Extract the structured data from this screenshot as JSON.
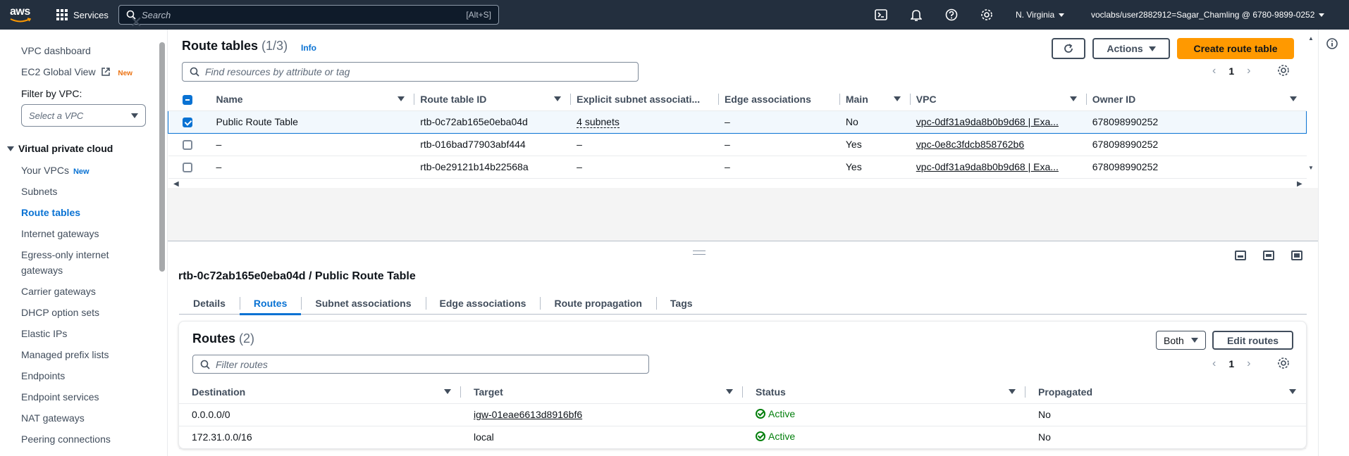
{
  "topnav": {
    "logo_text": "aws",
    "services_label": "Services",
    "search_placeholder": "Search",
    "search_shortcut": "[Alt+S]",
    "region": "N. Virginia",
    "account": "voclabs/user2882912=Sagar_Chamling @ 6780-9899-0252"
  },
  "sidebar": {
    "dashboard": "VPC dashboard",
    "ec2_global": "EC2 Global View",
    "ec2_badge": "New",
    "filter_label": "Filter by VPC:",
    "filter_placeholder": "Select a VPC",
    "section": "Virtual private cloud",
    "items": [
      {
        "label": "Your VPCs",
        "badge": "New"
      },
      {
        "label": "Subnets"
      },
      {
        "label": "Route tables"
      },
      {
        "label": "Internet gateways"
      },
      {
        "label": "Egress-only internet"
      },
      {
        "label": "gateways"
      },
      {
        "label": "Carrier gateways"
      },
      {
        "label": "DHCP option sets"
      },
      {
        "label": "Elastic IPs"
      },
      {
        "label": "Managed prefix lists"
      },
      {
        "label": "Endpoints"
      },
      {
        "label": "Endpoint services"
      },
      {
        "label": "NAT gateways"
      },
      {
        "label": "Peering connections"
      }
    ]
  },
  "header": {
    "title": "Route tables",
    "count": "(1/3)",
    "info": "Info",
    "actions": "Actions",
    "create": "Create route table",
    "find_placeholder": "Find resources by attribute or tag",
    "page": "1"
  },
  "route_table": {
    "columns": [
      "Name",
      "Route table ID",
      "Explicit subnet associati...",
      "Edge associations",
      "Main",
      "VPC",
      "Owner ID"
    ],
    "rows": [
      {
        "name": "Public Route Table",
        "id": "rtb-0c72ab165e0eba04d",
        "subnets": "4 subnets",
        "edge": "–",
        "main": "No",
        "vpc": "vpc-0df31a9da8b0b9d68 | Exa...",
        "owner": "678098990252"
      },
      {
        "name": "–",
        "id": "rtb-016bad77903abf444",
        "subnets": "–",
        "edge": "–",
        "main": "Yes",
        "vpc": "vpc-0e8c3fdcb858762b6",
        "owner": "678098990252"
      },
      {
        "name": "–",
        "id": "rtb-0e29121b14b22568a",
        "subnets": "–",
        "edge": "–",
        "main": "Yes",
        "vpc": "vpc-0df31a9da8b0b9d68 | Exa...",
        "owner": "678098990252"
      }
    ]
  },
  "detail": {
    "title": "rtb-0c72ab165e0eba04d / Public Route Table",
    "tabs": [
      "Details",
      "Routes",
      "Subnet associations",
      "Edge associations",
      "Route propagation",
      "Tags"
    ],
    "routes_title": "Routes",
    "routes_count": "(2)",
    "both": "Both",
    "edit_routes": "Edit routes",
    "filter_placeholder": "Filter routes",
    "page": "1",
    "columns": [
      "Destination",
      "Target",
      "Status",
      "Propagated"
    ],
    "rows": [
      {
        "destination": "0.0.0.0/0",
        "target": "igw-01eae6613d8916bf6",
        "status": "Active",
        "propagated": "No"
      },
      {
        "destination": "172.31.0.0/16",
        "target": "local",
        "status": "Active",
        "propagated": "No"
      }
    ]
  },
  "colors": {
    "nav_bg": "#232f3e",
    "link": "#0972d3",
    "primary": "#ff9900",
    "success": "#037f0c"
  }
}
